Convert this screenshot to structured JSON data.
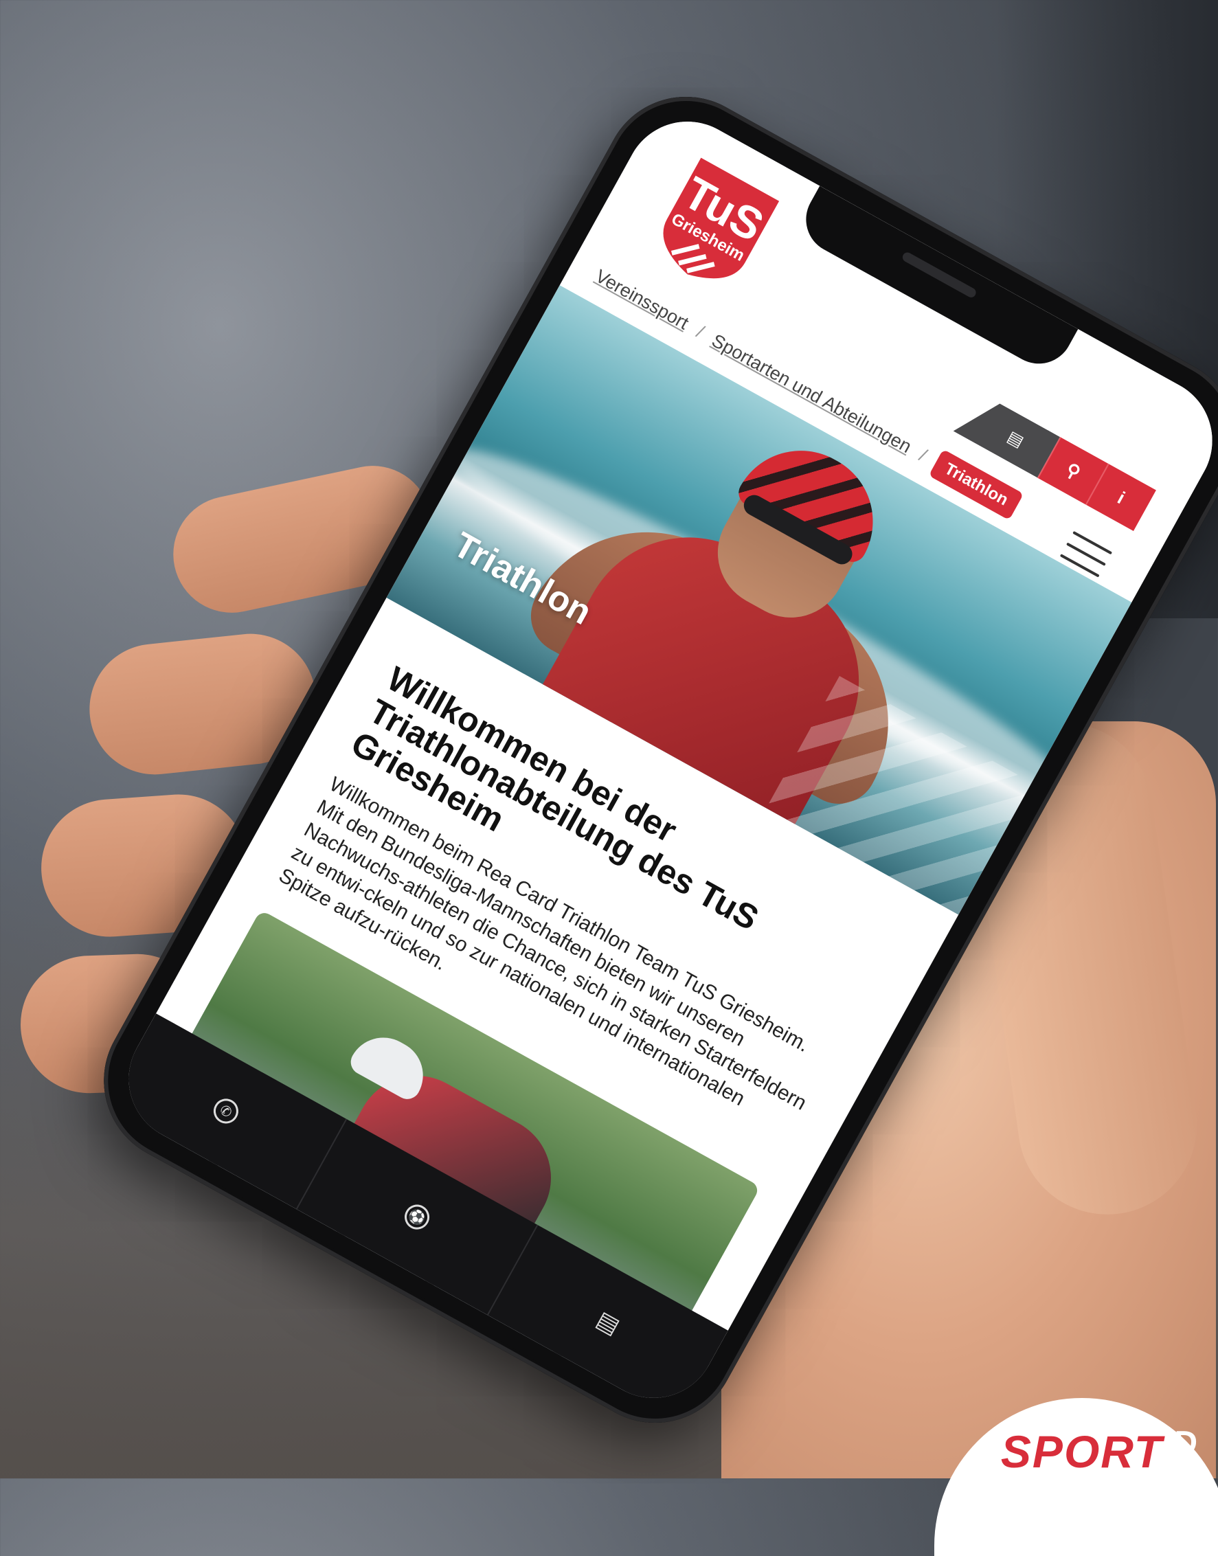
{
  "logo": {
    "line1": "TuS",
    "line2": "Griesheim",
    "brand_color": "#d82d3a"
  },
  "utility": {
    "newspaper_icon": "newspaper-icon",
    "search_icon": "search-icon",
    "info_label": "i"
  },
  "breadcrumb": {
    "items": [
      "Vereinssport",
      "Sportarten und Abteilungen"
    ],
    "separator": "/",
    "current": "Triathlon"
  },
  "hero": {
    "title": "Triathlon"
  },
  "main": {
    "heading": "Willkommen bei der Triathlonabteilung des TuS Griesheim",
    "body": "Willkommen beim Rea Card Triathlon Team TuS Griesheim. Mit den Bundesliga-Mannschaften bieten wir unseren Nachwuchs-athleten die Chance, sich in starken Starterfeldern zu entwi-ckeln und so zur nationalen und internationalen Spitze aufzu-rücken."
  },
  "bottom_bar": {
    "icons": [
      "phone-icon",
      "soccer-ball-icon",
      "id-card-icon"
    ]
  },
  "badge": {
    "text": "SPORT",
    "side_letter": "D"
  }
}
